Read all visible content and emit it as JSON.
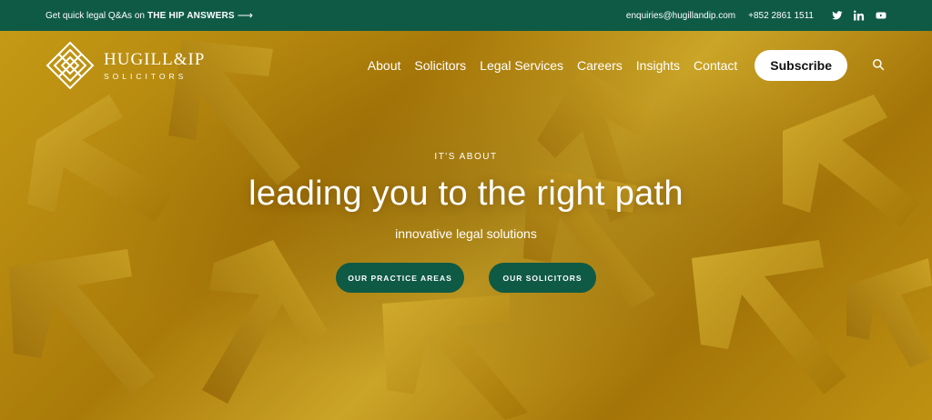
{
  "topbar": {
    "promo_text": "Get quick legal Q&As on",
    "promo_strong": "THE HIP ANSWERS",
    "promo_arrow": "⟶",
    "email": "enquiries@hugillandip.com",
    "phone": "+852 2861 1511",
    "social": [
      "twitter-icon",
      "linkedin-icon",
      "youtube-icon"
    ]
  },
  "logo": {
    "name": "HUGILL&IP",
    "sub": "SOLICITORS"
  },
  "nav": {
    "items": [
      "About",
      "Solicitors",
      "Legal Services",
      "Careers",
      "Insights",
      "Contact"
    ],
    "subscribe": "Subscribe"
  },
  "hero": {
    "eyebrow": "IT'S ABOUT",
    "headline": "leading you to the right path",
    "tagline": "innovative legal solutions",
    "cta_primary": "OUR PRACTICE AREAS",
    "cta_secondary": "OUR SOLICITORS"
  },
  "colors": {
    "brand_green": "#0f5a45",
    "hero_gold": "#d9a816",
    "white": "#ffffff"
  }
}
